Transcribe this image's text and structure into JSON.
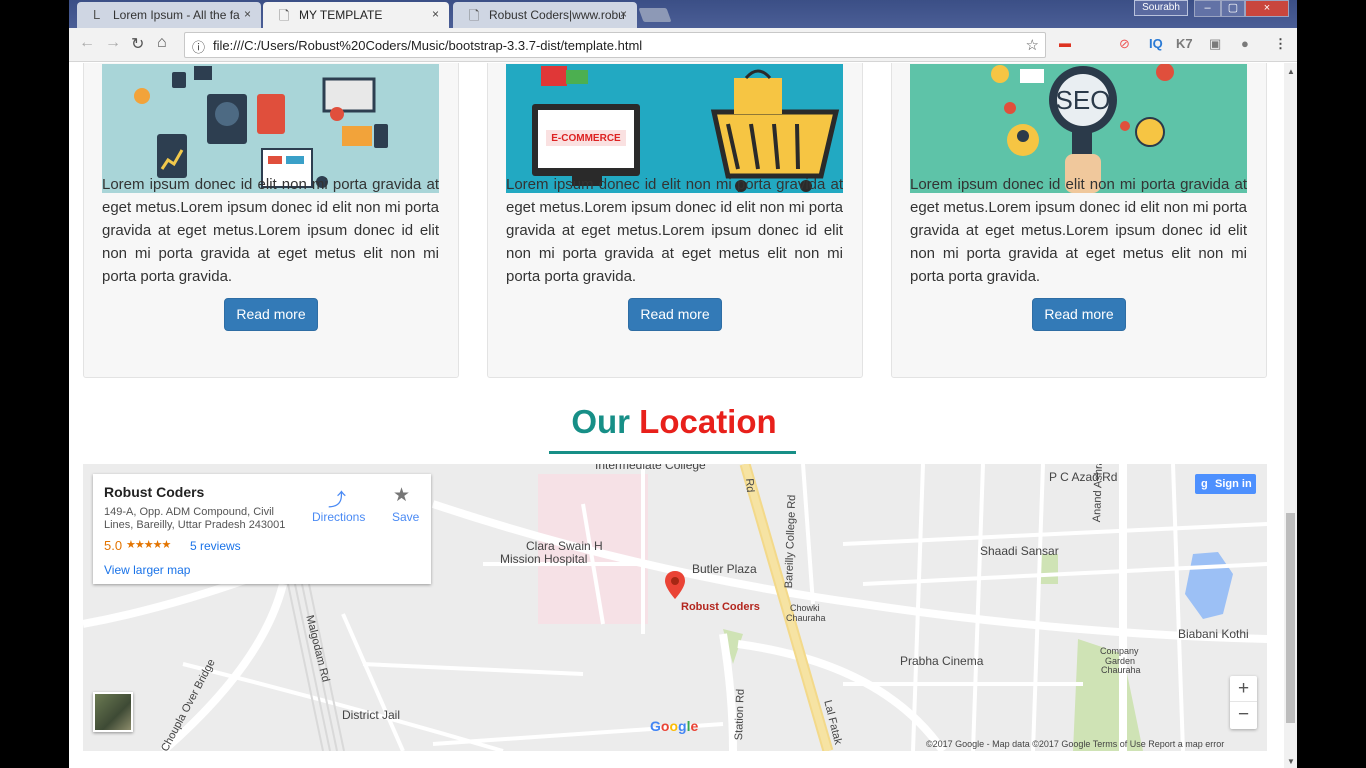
{
  "browser": {
    "tabs": [
      {
        "label": "Lorem Ipsum - All the fa",
        "icon": "L",
        "close": "×"
      },
      {
        "label": "MY TEMPLATE",
        "icon": "🗋",
        "close": "×"
      },
      {
        "label": "Robust Coders|www.robu",
        "icon": "🗋",
        "close": "×"
      }
    ],
    "window_user": "Sourabh",
    "window_buttons": {
      "min": "–",
      "max": "▢",
      "close": "×"
    },
    "nav": {
      "back": "←",
      "forward": "→",
      "reload": "↻",
      "home": "⌂"
    },
    "address": {
      "info_icon": "ⓘ",
      "url": "file:///C:/Users/Robust%20Coders/Music/bootstrap-3.3.7-dist/template.html",
      "star": "☆"
    },
    "extensions": [
      "IQ",
      "K7",
      "⋮"
    ]
  },
  "cards": [
    {
      "text": "Lorem ipsum donec id elit non mi porta gravida at eget metus.Lorem ipsum donec id elit non mi porta gravida at eget metus.Lorem ipsum donec id elit non mi porta gravida at eget metus elit non mi porta porta gravida.",
      "button": "Read more"
    },
    {
      "text": "Lorem ipsum donec id elit non mi porta gravida at eget metus.Lorem ipsum donec id elit non mi porta gravida at eget metus.Lorem ipsum donec id elit non mi porta gravida at eget metus elit non mi porta porta gravida.",
      "button": "Read more",
      "banner": "E-COMMERCE"
    },
    {
      "text": "Lorem ipsum donec id elit non mi porta gravida at eget metus.Lorem ipsum donec id elit non mi porta gravida at eget metus.Lorem ipsum donec id elit non mi porta gravida at eget metus elit non mi porta porta gravida.",
      "button": "Read more",
      "banner": "SEO"
    }
  ],
  "location": {
    "word1": "Our",
    "word2": "Location"
  },
  "map": {
    "infocard": {
      "name": "Robust Coders",
      "address": "149-A, Opp. ADM Compound, Civil Lines, Bareilly, Uttar Pradesh 243001",
      "rating": "5.0",
      "stars": "★★★★★",
      "reviews": "5 reviews",
      "larger": "View larger map",
      "directions": "Directions",
      "save": "Save"
    },
    "signin": "Sign in",
    "labels": {
      "intermediate": "Intermediate College",
      "pcazad": "P C Azad Rd",
      "anand": "Anand Ashram Rd",
      "clara": "Clara Swain H",
      "mission": "Mission Hospital",
      "butler": "Butler Plaza",
      "bareilly_college": "Bareilly College Rd",
      "shaadi": "Shaadi Sansar",
      "robust": "Robust Coders",
      "chowki": "Chowki",
      "chauraha": "Chauraha",
      "biabani": "Biabani Kothi",
      "malgodam": "Malgodam Rd",
      "choupla": "Choupla Over Bridge",
      "prabha": "Prabha Cinema",
      "company": "Company",
      "garden": "Garden",
      "company_chauraha": "Chauraha",
      "district": "District Jail",
      "station": "Station Rd",
      "lal": "Lal Fatak",
      "rd": "Rd"
    },
    "google": "Google",
    "footer": "©2017 Google - Map data ©2017 Google    Terms of Use    Report a map error",
    "zoom_in": "+",
    "zoom_out": "−"
  }
}
